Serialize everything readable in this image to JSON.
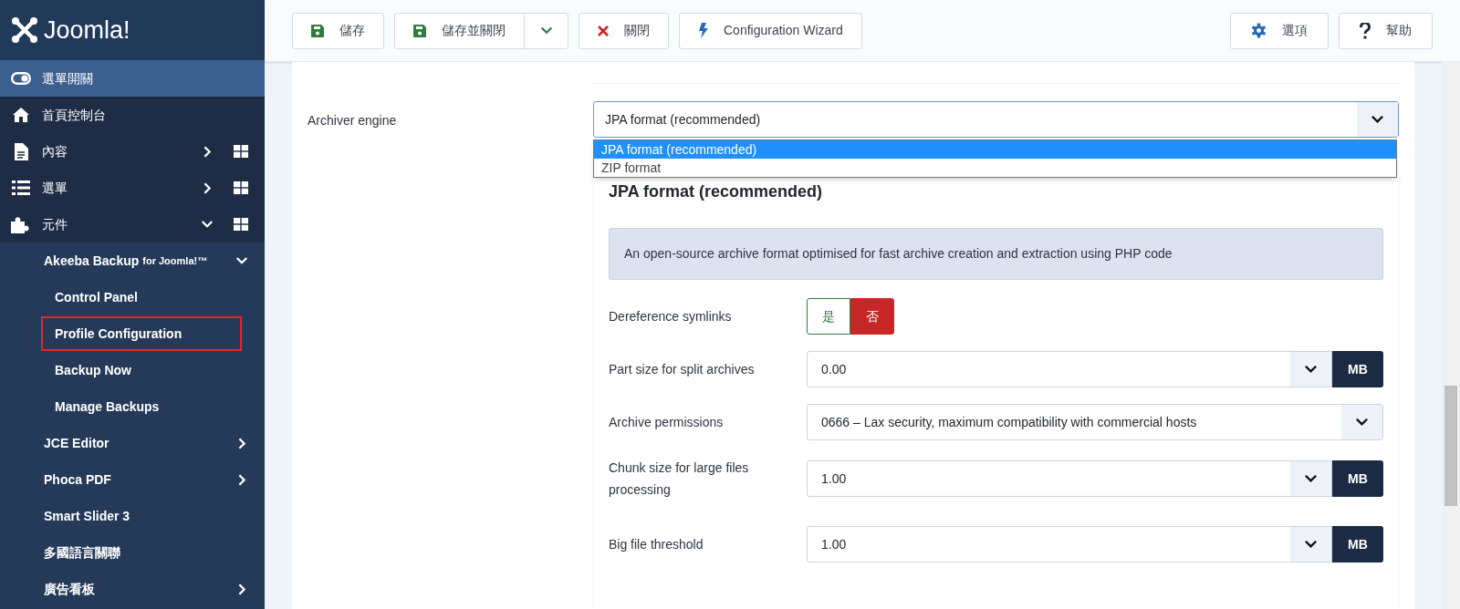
{
  "brand": {
    "name": "Joomla!"
  },
  "sidebar": {
    "toggle": {
      "label": "選單開關"
    },
    "items": [
      {
        "kind": "top",
        "label": "首頁控制台",
        "selected": false
      },
      {
        "kind": "top",
        "label": "內容",
        "expanded": false,
        "selected": false
      },
      {
        "kind": "top",
        "label": "選單",
        "expanded": false,
        "selected": false
      },
      {
        "kind": "top",
        "label": "元件",
        "expanded": true,
        "selected": false
      },
      {
        "kind": "sub",
        "label": "Akeeba Backup",
        "suffix": "for Joomla!™",
        "expanded": true,
        "selected": false
      },
      {
        "kind": "subsub",
        "label": "Control Panel",
        "selected": false
      },
      {
        "kind": "subsub",
        "label": "Profile Configuration",
        "selected": true
      },
      {
        "kind": "subsub",
        "label": "Backup Now",
        "selected": false
      },
      {
        "kind": "subsub",
        "label": "Manage Backups",
        "selected": false
      },
      {
        "kind": "sub",
        "label": "JCE Editor",
        "expanded": false,
        "selected": false
      },
      {
        "kind": "sub",
        "label": "Phoca PDF",
        "expanded": false,
        "selected": false
      },
      {
        "kind": "sub",
        "label": "Smart Slider 3",
        "selected": false
      },
      {
        "kind": "sub",
        "label": "多國語言關聯",
        "selected": false
      },
      {
        "kind": "sub",
        "label": "廣告看板",
        "expanded": false,
        "selected": false
      }
    ]
  },
  "toolbar": {
    "left": [
      {
        "kind": "button",
        "label": "儲存"
      },
      {
        "kind": "split",
        "label": "儲存並關閉"
      },
      {
        "kind": "button",
        "label": "關閉"
      },
      {
        "kind": "button",
        "label": "Configuration Wizard"
      }
    ],
    "right": [
      {
        "label": "選項"
      },
      {
        "label": "幫助"
      }
    ]
  },
  "archiver": {
    "label": "Archiver engine",
    "value": "JPA format (recommended)",
    "expanded": true,
    "options": [
      {
        "label": "JPA format (recommended)",
        "selected": true
      },
      {
        "label": "ZIP format",
        "selected": false
      }
    ]
  },
  "engine_panel": {
    "heading": "JPA format (recommended)",
    "info": "An open-source archive format optimised for fast archive creation and extraction using PHP code",
    "fields": [
      {
        "kind": "toggle",
        "label": "Dereference symlinks",
        "yes": "是",
        "no": "否",
        "on": false
      },
      {
        "kind": "number",
        "label": "Part size for split archives",
        "value": "0.00",
        "unit": "MB"
      },
      {
        "kind": "select",
        "label": "Archive permissions",
        "value": "0666 – Lax security, maximum compatibility with commercial hosts"
      },
      {
        "kind": "number",
        "label": "Chunk size for large files processing",
        "value": "1.00",
        "unit": "MB"
      },
      {
        "kind": "number",
        "label": "Big file threshold",
        "value": "1.00",
        "unit": "MB"
      }
    ]
  }
}
